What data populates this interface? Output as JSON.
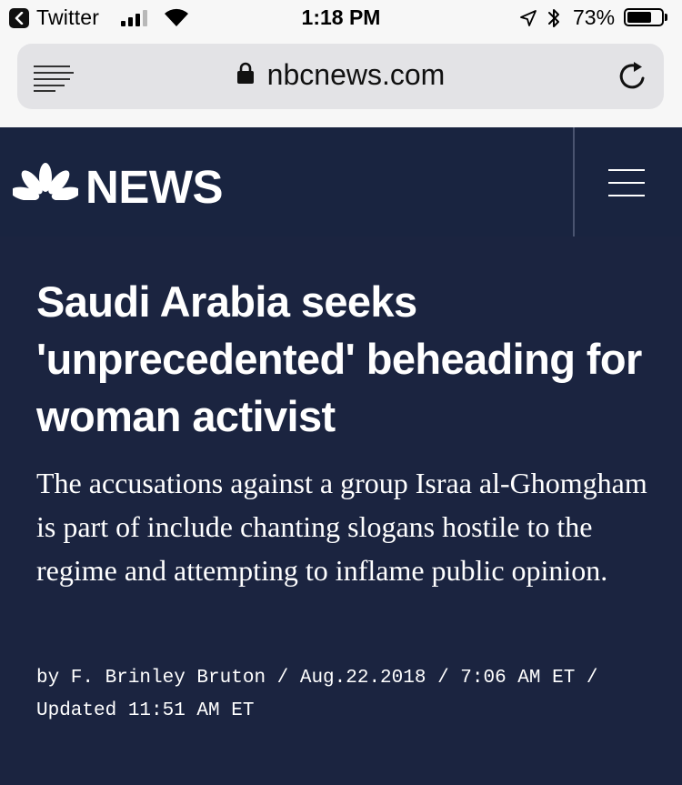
{
  "status_bar": {
    "back_app": "Twitter",
    "time": "1:18 PM",
    "battery_percent": "73%",
    "battery_level": 0.73,
    "signal_bars_filled": 3,
    "signal_bars_total": 4
  },
  "browser": {
    "url": "nbcnews.com"
  },
  "header": {
    "brand": "NEWS",
    "brand_color": "#192440"
  },
  "article": {
    "headline": "Saudi Arabia seeks 'unprecedented' beheading for woman activist",
    "summary": "The accusations against a group Israa al-Ghomgham is part of include chanting slogans hostile to the regime and attempting to inflame public opinion.",
    "byline": "by F. Brinley Bruton / Aug.22.2018 / 7:06 AM ET / Updated 11:51 AM ET"
  },
  "icons": {
    "back": "chevron-left-icon",
    "signal": "cellular-signal-icon",
    "wifi": "wifi-icon",
    "location": "location-arrow-icon",
    "bluetooth": "bluetooth-icon",
    "battery": "battery-icon",
    "reader": "reader-mode-icon",
    "lock": "lock-icon",
    "reload": "reload-icon",
    "logo": "nbc-peacock-icon",
    "menu": "hamburger-menu-icon"
  }
}
